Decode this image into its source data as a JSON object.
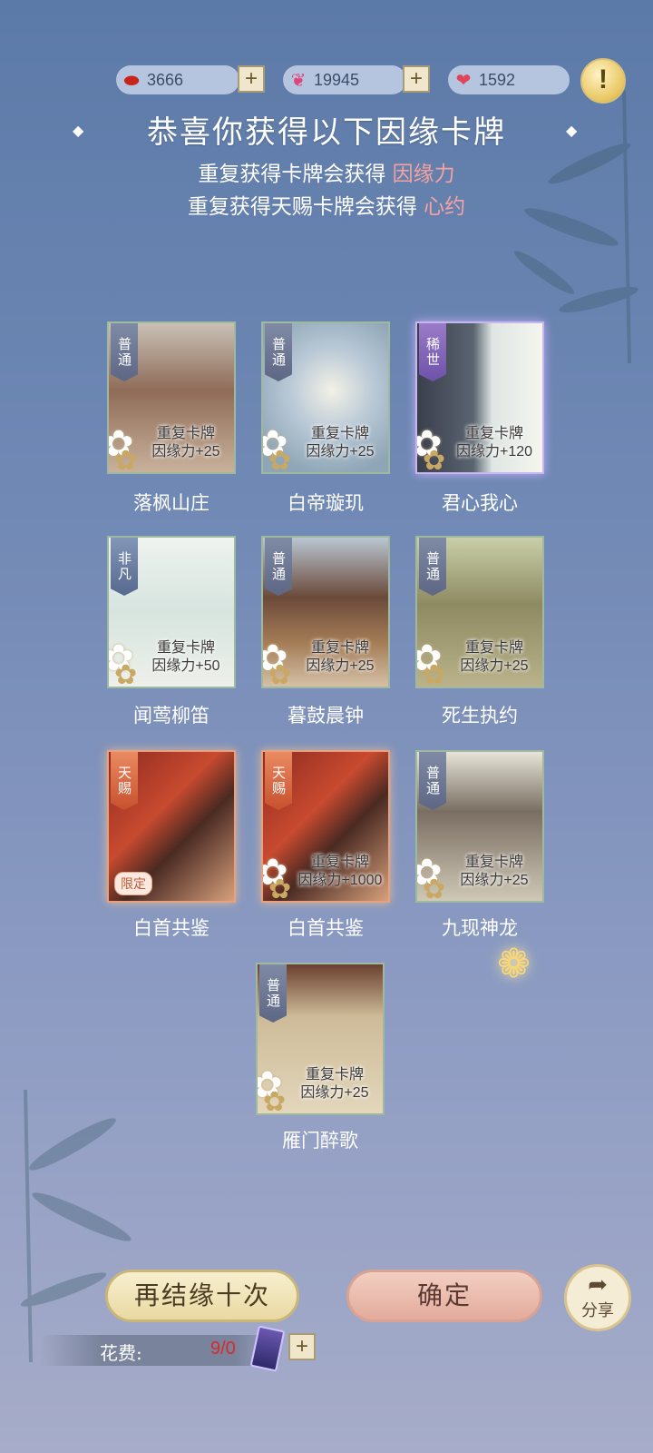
{
  "currency": [
    {
      "icon": "red-bean-icon",
      "value": "3666"
    },
    {
      "icon": "butterfly-icon",
      "value": "19945"
    },
    {
      "icon": "heart-icon",
      "value": "1592"
    }
  ],
  "header": {
    "title": "恭喜你获得以下因缘卡牌",
    "line1_prefix": "重复获得卡牌会获得 ",
    "line1_highlight": "因缘力",
    "line2_prefix": "重复获得天赐卡牌会获得 ",
    "line2_highlight": "心约"
  },
  "cards": [
    {
      "name": "落枫山庄",
      "tag": "普通",
      "dup1": "重复卡牌",
      "dup2": "因缘力+25"
    },
    {
      "name": "白帝璇玑",
      "tag": "普通",
      "dup1": "重复卡牌",
      "dup2": "因缘力+25"
    },
    {
      "name": "君心我心",
      "tag": "稀世",
      "dup1": "重复卡牌",
      "dup2": "因缘力+120"
    },
    {
      "name": "闻莺柳笛",
      "tag": "非凡",
      "dup1": "重复卡牌",
      "dup2": "因缘力+50"
    },
    {
      "name": "暮鼓晨钟",
      "tag": "普通",
      "dup1": "重复卡牌",
      "dup2": "因缘力+25"
    },
    {
      "name": "死生执约",
      "tag": "普通",
      "dup1": "重复卡牌",
      "dup2": "因缘力+25"
    },
    {
      "name": "白首共鉴",
      "tag": "天赐",
      "badge": "限定"
    },
    {
      "name": "白首共鉴",
      "tag": "天赐",
      "dup1": "重复卡牌",
      "dup2": "因缘力+1000"
    },
    {
      "name": "九现神龙",
      "tag": "普通",
      "dup1": "重复卡牌",
      "dup2": "因缘力+25"
    },
    {
      "name": "雁门醉歌",
      "tag": "普通",
      "dup1": "重复卡牌",
      "dup2": "因缘力+25"
    }
  ],
  "buttons": {
    "again": "再结缘十次",
    "confirm": "确定",
    "share": "分享"
  },
  "cost": {
    "label": "花费:",
    "value": "9/0"
  }
}
